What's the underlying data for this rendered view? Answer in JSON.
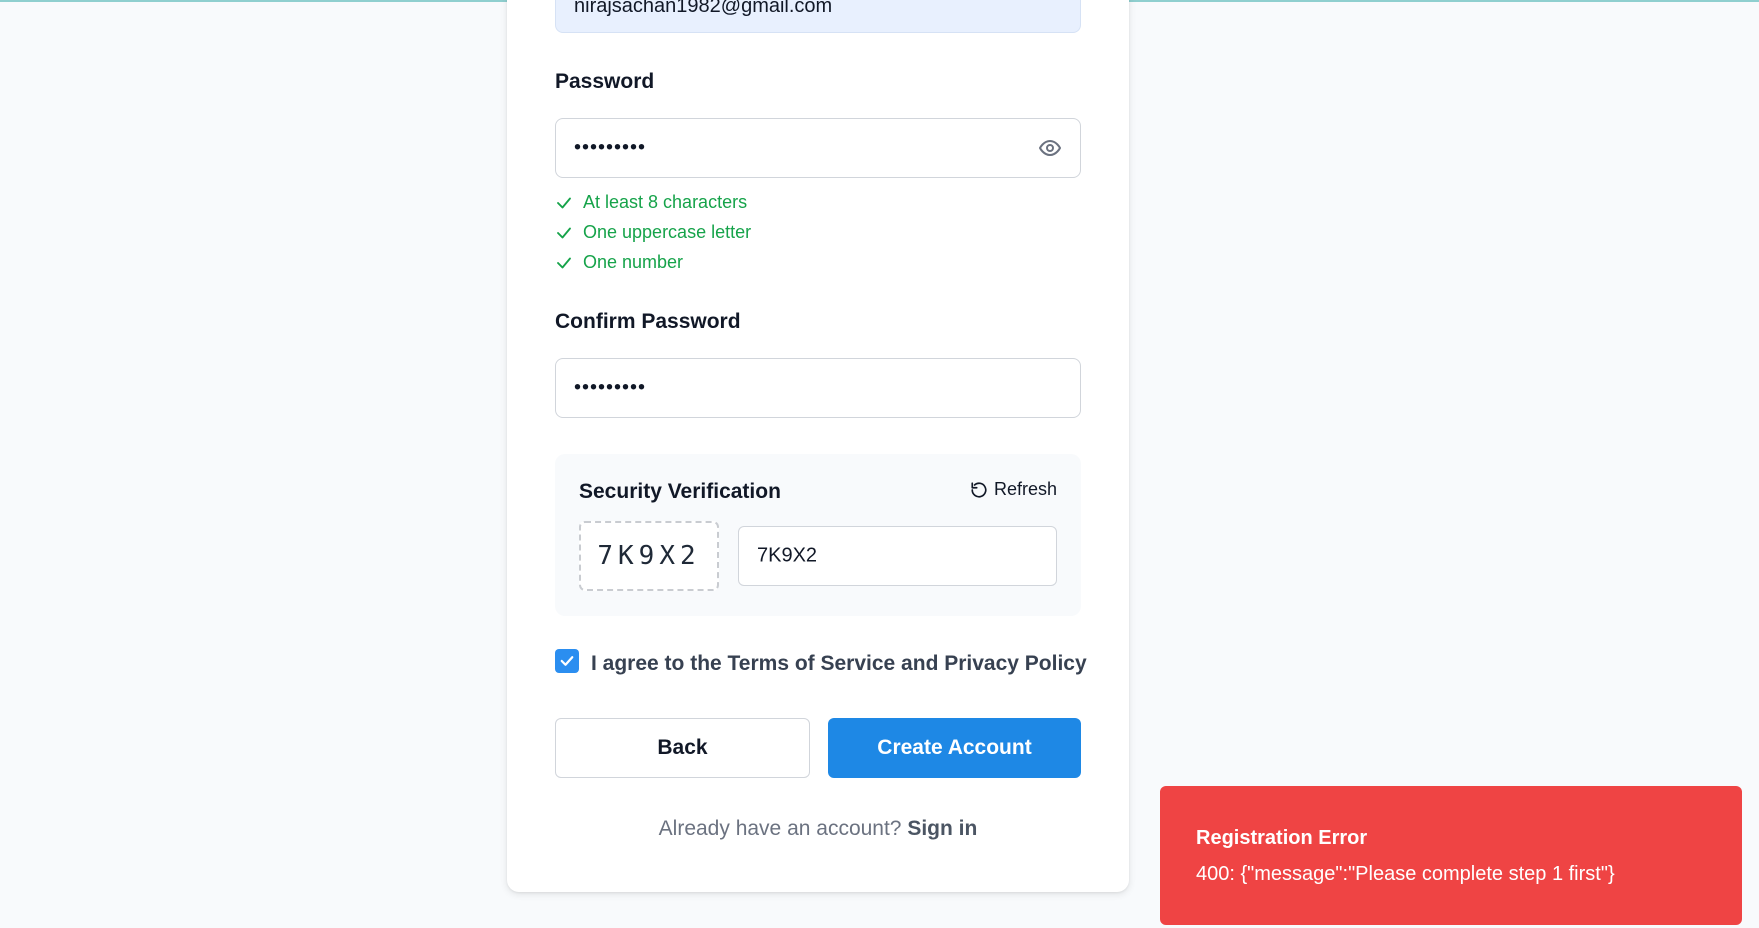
{
  "email": {
    "value": "nirajsachan1982@gmail.com"
  },
  "password": {
    "label": "Password",
    "value": "•••••••••",
    "toggle_icon": "eye-icon"
  },
  "requirements": [
    {
      "text": "At least 8 characters",
      "icon": "check-icon"
    },
    {
      "text": "One uppercase letter",
      "icon": "check-icon"
    },
    {
      "text": "One number",
      "icon": "check-icon"
    }
  ],
  "confirm_password": {
    "label": "Confirm Password",
    "value": "•••••••••"
  },
  "security": {
    "title": "Security Verification",
    "refresh_label": "Refresh",
    "captcha_code": "7K9X2",
    "captcha_input_value": "7K9X2"
  },
  "agree": {
    "checked": true,
    "text": "I agree to the Terms of Service and Privacy Policy"
  },
  "buttons": {
    "back": "Back",
    "create": "Create Account"
  },
  "signin": {
    "prompt": "Already have an account?",
    "link": "Sign in"
  },
  "toast": {
    "title": "Registration Error",
    "message": "400: {\"message\":\"Please complete step 1 first\"}"
  },
  "colors": {
    "primary": "#1e88e5",
    "success": "#16a34a",
    "error": "#ef4444"
  }
}
